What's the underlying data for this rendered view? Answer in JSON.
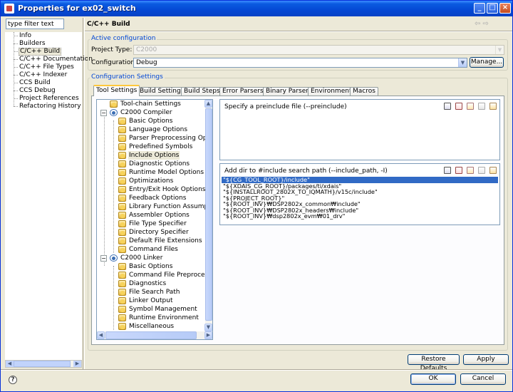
{
  "window": {
    "title": "Properties for ex02_switch",
    "minimize": "_",
    "maximize": "□",
    "close": "×"
  },
  "sidebar": {
    "filter_value": "type filter text",
    "items": [
      {
        "label": "Info"
      },
      {
        "label": "Builders"
      },
      {
        "label": "C/C++ Build",
        "selected": true
      },
      {
        "label": "C/C++ Documentation"
      },
      {
        "label": "C/C++ File Types"
      },
      {
        "label": "C/C++ Indexer"
      },
      {
        "label": "CCS Build"
      },
      {
        "label": "CCS Debug"
      },
      {
        "label": "Project References"
      },
      {
        "label": "Refactoring History"
      }
    ]
  },
  "header": {
    "title": "C/C++ Build",
    "back": "⇦",
    "forward": "⇨"
  },
  "active_config": {
    "group_label": "Active configuration",
    "project_type_label": "Project Type:",
    "project_type_value": "C2000",
    "configuration_label": "Configuration:",
    "configuration_value": "Debug",
    "manage_label": "Manage..."
  },
  "config_settings": {
    "group_label": "Configuration Settings",
    "tabs": [
      {
        "label": "Tool Settings",
        "active": true
      },
      {
        "label": "Build Settings"
      },
      {
        "label": "Build Steps"
      },
      {
        "label": "Error Parsers"
      },
      {
        "label": "Binary Parser"
      },
      {
        "label": "Environment"
      },
      {
        "label": "Macros"
      }
    ]
  },
  "tool_tree": {
    "toolchain": "Tool-chain Settings",
    "compiler": "C2000 Compiler",
    "compiler_items": [
      "Basic Options",
      "Language Options",
      "Parser Preprocessing Options",
      "Predefined Symbols",
      "Include Options",
      "Diagnostic Options",
      "Runtime Model Options",
      "Optimizations",
      "Entry/Exit Hook Options",
      "Feedback Options",
      "Library Function Assumptions",
      "Assembler Options",
      "File Type Specifier",
      "Directory Specifier",
      "Default File Extensions",
      "Command Files"
    ],
    "linker": "C2000 Linker",
    "linker_items": [
      "Basic Options",
      "Command File Preprocessing",
      "Diagnostics",
      "File Search Path",
      "Linker Output",
      "Symbol Management",
      "Runtime Environment",
      "Miscellaneous"
    ],
    "selected": "Include Options"
  },
  "preinclude": {
    "header": "Specify a preinclude file (--preinclude)"
  },
  "include_path": {
    "header": "Add dir to #include search path (--include_path, -I)",
    "items": [
      "\"${CG_TOOL_ROOT}/include\"",
      "\"${XDAIS_CG_ROOT}/packages/ti/xdais\"",
      "\"${INSTALLROOT_2802X_TO_IQMATH}/v15c/include\"",
      "\"${PROJECT_ROOT}\"",
      "\"${ROOT_INV}₩DSP2802x_common₩include\"",
      "\"${ROOT_INV}₩DSP2802x_headers₩include\"",
      "\"${ROOT_INV}₩dsp2802x_evm₩01_drv\""
    ],
    "selected_index": 0
  },
  "actions": {
    "restore_defaults": "Restore Defaults",
    "apply": "Apply",
    "ok": "OK",
    "cancel": "Cancel",
    "help": "?"
  }
}
